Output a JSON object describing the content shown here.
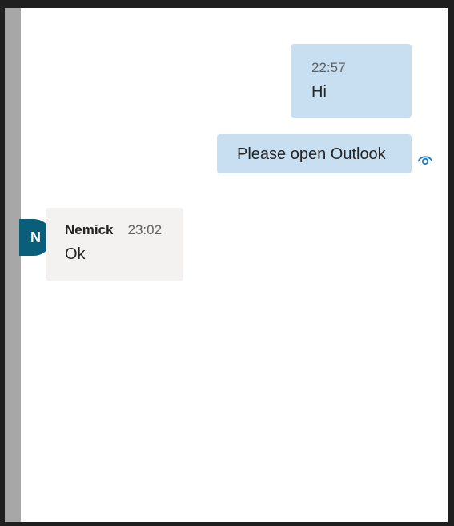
{
  "messages": [
    {
      "time": "22:57",
      "text": "Hi",
      "from_self": true
    },
    {
      "text": "Please open Outlook",
      "from_self": true,
      "status_icon": "seen-eye-icon"
    },
    {
      "sender": "Nemick",
      "avatar_initial": "N",
      "time": "23:02",
      "text": "Ok",
      "from_self": false
    }
  ],
  "colors": {
    "self_bubble": "#c8dff2",
    "other_bubble": "#f3f2f1",
    "avatar": "#0b5e7a",
    "seen_icon": "#1f7ac0"
  }
}
